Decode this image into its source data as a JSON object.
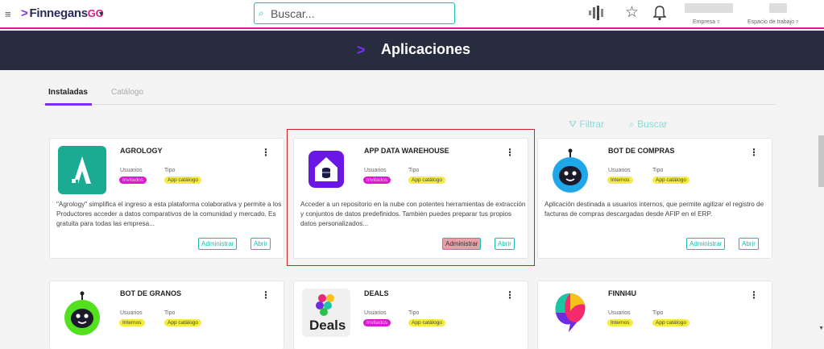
{
  "topbar": {
    "menu_icon": "hamburger-icon",
    "brand_main": "Finnegans",
    "brand_go": "GO",
    "brand_caret": "▾",
    "search_placeholder": "Buscar...",
    "empresa_label": "Empresa ▿",
    "workspace_label": "Espacio de trabajo ▿"
  },
  "header": {
    "title": "Aplicaciones"
  },
  "tabs": [
    {
      "label": "Instaladas",
      "active": true
    },
    {
      "label": "Catálogo",
      "active": false
    }
  ],
  "toolbar": {
    "filter_label": "Filtrar",
    "search_label": "Buscar"
  },
  "cards": [
    {
      "title": "AGROLOGY",
      "usuarios_label": "Usuarios",
      "tipo_label": "Tipo",
      "usuarios_tag": "Invitados",
      "tipo_tag": "App catálogo",
      "desc": "\"Agrology\" simplifica el ingreso a esta plataforma colaborativa y permite a los Productores acceder a datos comparativos de la comunidad y mercado. Es gratuita para todas las empresa...",
      "admin": "Administrar",
      "open": "Abrir"
    },
    {
      "title": "APP DATA WAREHOUSE",
      "usuarios_label": "Usuarios",
      "tipo_label": "Tipo",
      "usuarios_tag": "Invitados",
      "tipo_tag": "App catálogo",
      "desc": "Acceder a un repositorio en la nube con potentes herramientas de extracción y conjuntos de datos predefinidos. También puedes preparar tus propios datos personalizados...",
      "admin": "Administrar",
      "open": "Abrir"
    },
    {
      "title": "BOT DE COMPRAS",
      "usuarios_label": "Usuarios",
      "tipo_label": "Tipo",
      "usuarios_tag": "Internos",
      "tipo_tag": "App catálogo",
      "desc": "Aplicación destinada a usuarios internos, que permite agilizar el registro de facturas de compras descargadas desde AFIP en el ERP.",
      "admin": "Administrar",
      "open": "Abrir"
    },
    {
      "title": "BOT DE GRANOS",
      "usuarios_label": "Usuarios",
      "tipo_label": "Tipo",
      "usuarios_tag": "Internos",
      "tipo_tag": "App catálogo"
    },
    {
      "title": "DEALS",
      "usuarios_label": "Usuarios",
      "tipo_label": "Tipo",
      "usuarios_tag": "Invitados",
      "tipo_tag": "App catálogo",
      "logo_text": "Deals"
    },
    {
      "title": "FINNI4U",
      "usuarios_label": "Usuarios",
      "tipo_label": "Tipo",
      "usuarios_tag": "Internos",
      "tipo_tag": "App catálogo"
    }
  ],
  "colors": {
    "accent": "#7b2ff7",
    "teal": "#1bbdb2",
    "magenta": "#d91a8c",
    "header_bg": "#272c3f"
  }
}
